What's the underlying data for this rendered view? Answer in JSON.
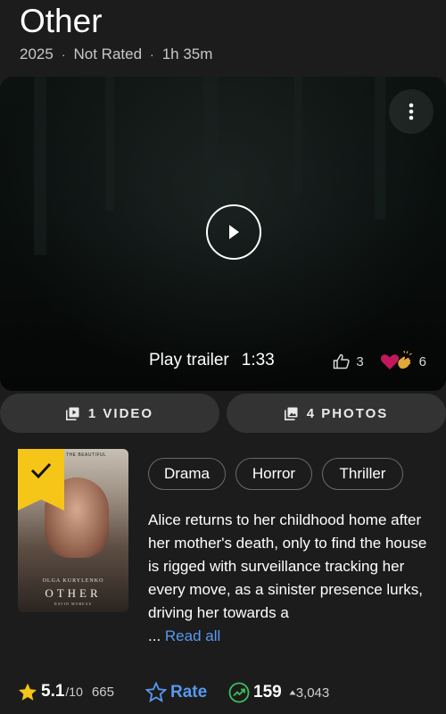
{
  "title": "Other",
  "meta": {
    "year": "2025",
    "rating": "Not Rated",
    "runtime": "1h 35m",
    "separator": "·"
  },
  "trailer": {
    "label": "Play trailer",
    "duration": "1:33",
    "likes": "3",
    "reactions": "6",
    "menu_icon": "more-vert-icon",
    "play_icon": "play-icon"
  },
  "media": {
    "videos_label": "1 VIDEO",
    "photos_label": "4 PHOTOS"
  },
  "poster": {
    "tagline": "THE BEAUTIFUL",
    "actor": "OLGA KURYLENKO",
    "title": "OTHER",
    "director": "DAVID MOREAU"
  },
  "genres": [
    "Drama",
    "Horror",
    "Thriller"
  ],
  "plot": {
    "text": "Alice returns to her childhood home after her mother's death, only to find the house is rigged with surveillance tracking her every move, as a sinister presence lurks, driving her towards a",
    "ellipsis": "...",
    "read_all": "Read all"
  },
  "stats": {
    "score": "5.1",
    "out_of": "/10",
    "votes": "665",
    "rate_label": "Rate",
    "meter_rank": "159",
    "meter_change": "3,043"
  },
  "colors": {
    "accent_yellow": "#f5c518",
    "link_blue": "#5799ef",
    "meter_green": "#3cbf5a",
    "background": "#1c1c1c"
  }
}
